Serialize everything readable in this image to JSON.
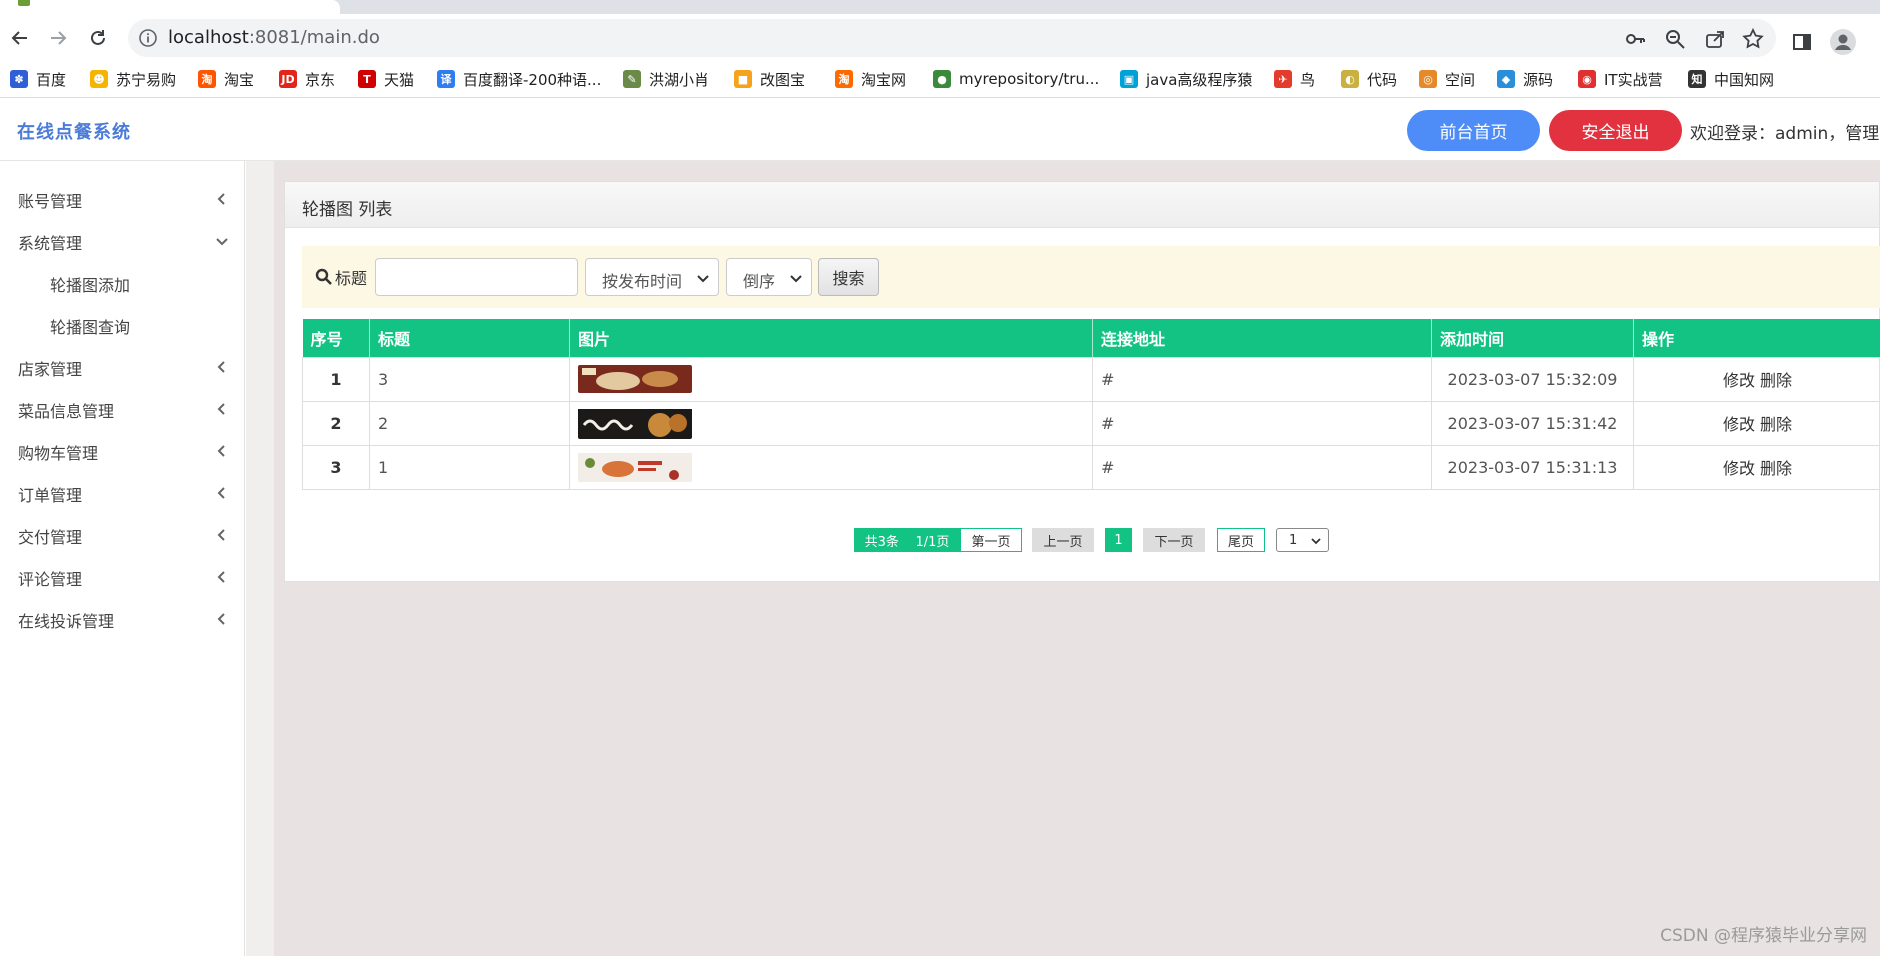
{
  "browser": {
    "url_host": "localhost",
    "url_rest": ":8081/main.do",
    "bookmarks": [
      {
        "label": "百度",
        "color": "#2f5fd6",
        "glyph": "✽"
      },
      {
        "label": "苏宁易购",
        "color": "#f5b400",
        "glyph": "☻"
      },
      {
        "label": "淘宝",
        "color": "#ff5500",
        "glyph": "淘"
      },
      {
        "label": "京东",
        "color": "#e1251b",
        "glyph": "JD"
      },
      {
        "label": "天猫",
        "color": "#d00000",
        "glyph": "T"
      },
      {
        "label": "百度翻译-200种语...",
        "color": "#2e7df2",
        "glyph": "译"
      },
      {
        "label": "洪湖小肖",
        "color": "#6a8a4a",
        "glyph": "✎"
      },
      {
        "label": "改图宝",
        "color": "#f7a21b",
        "glyph": "■"
      },
      {
        "label": "淘宝网",
        "color": "#ff6a00",
        "glyph": "淘"
      },
      {
        "label": "myrepository/tru...",
        "color": "#3b8a3b",
        "glyph": "●"
      },
      {
        "label": "java高级程序猿",
        "color": "#00a1d6",
        "glyph": "▣"
      },
      {
        "label": "鸟",
        "color": "#e33b2e",
        "glyph": "✈"
      },
      {
        "label": "代码",
        "color": "#c9b040",
        "glyph": "◐"
      },
      {
        "label": "空间",
        "color": "#e58a2b",
        "glyph": "◎"
      },
      {
        "label": "源码",
        "color": "#2a8fd8",
        "glyph": "◆"
      },
      {
        "label": "IT实战营",
        "color": "#e0302f",
        "glyph": "◉"
      },
      {
        "label": "中国知网",
        "color": "#333333",
        "glyph": "知"
      }
    ]
  },
  "app": {
    "title": "在线点餐系统",
    "home_button": "前台首页",
    "logout_button": "安全退出",
    "welcome": "欢迎登录：admin，管理员"
  },
  "sidebar": {
    "items": [
      {
        "label": "账号管理",
        "expanded": false
      },
      {
        "label": "系统管理",
        "expanded": true
      },
      {
        "label": "店家管理",
        "expanded": false
      },
      {
        "label": "菜品信息管理",
        "expanded": false
      },
      {
        "label": "购物车管理",
        "expanded": false
      },
      {
        "label": "订单管理",
        "expanded": false
      },
      {
        "label": "交付管理",
        "expanded": false
      },
      {
        "label": "评论管理",
        "expanded": false
      },
      {
        "label": "在线投诉管理",
        "expanded": false
      }
    ],
    "subitems": [
      "轮播图添加",
      "轮播图查询"
    ]
  },
  "panel": {
    "title": "轮播图 列表",
    "search": {
      "label": "标题",
      "value": "",
      "order_by": "按发布时间",
      "order": "倒序",
      "button": "搜索"
    },
    "table": {
      "headers": [
        "序号",
        "标题",
        "图片",
        "连接地址",
        "添加时间",
        "操作"
      ],
      "rows": [
        {
          "no": "1",
          "title": "3",
          "link": "#",
          "time": "2023-03-07 15:32:09",
          "edit": "修改",
          "del": "删除"
        },
        {
          "no": "2",
          "title": "2",
          "link": "#",
          "time": "2023-03-07 15:31:42",
          "edit": "修改",
          "del": "删除"
        },
        {
          "no": "3",
          "title": "1",
          "link": "#",
          "time": "2023-03-07 15:31:13",
          "edit": "修改",
          "del": "删除"
        }
      ]
    },
    "pager": {
      "total": "共3条",
      "pages": "1/1页",
      "first": "第一页",
      "prev": "上一页",
      "current": "1",
      "next": "下一页",
      "last": "尾页",
      "select": "1"
    }
  },
  "watermark": "CSDN @程序猿毕业分享网"
}
